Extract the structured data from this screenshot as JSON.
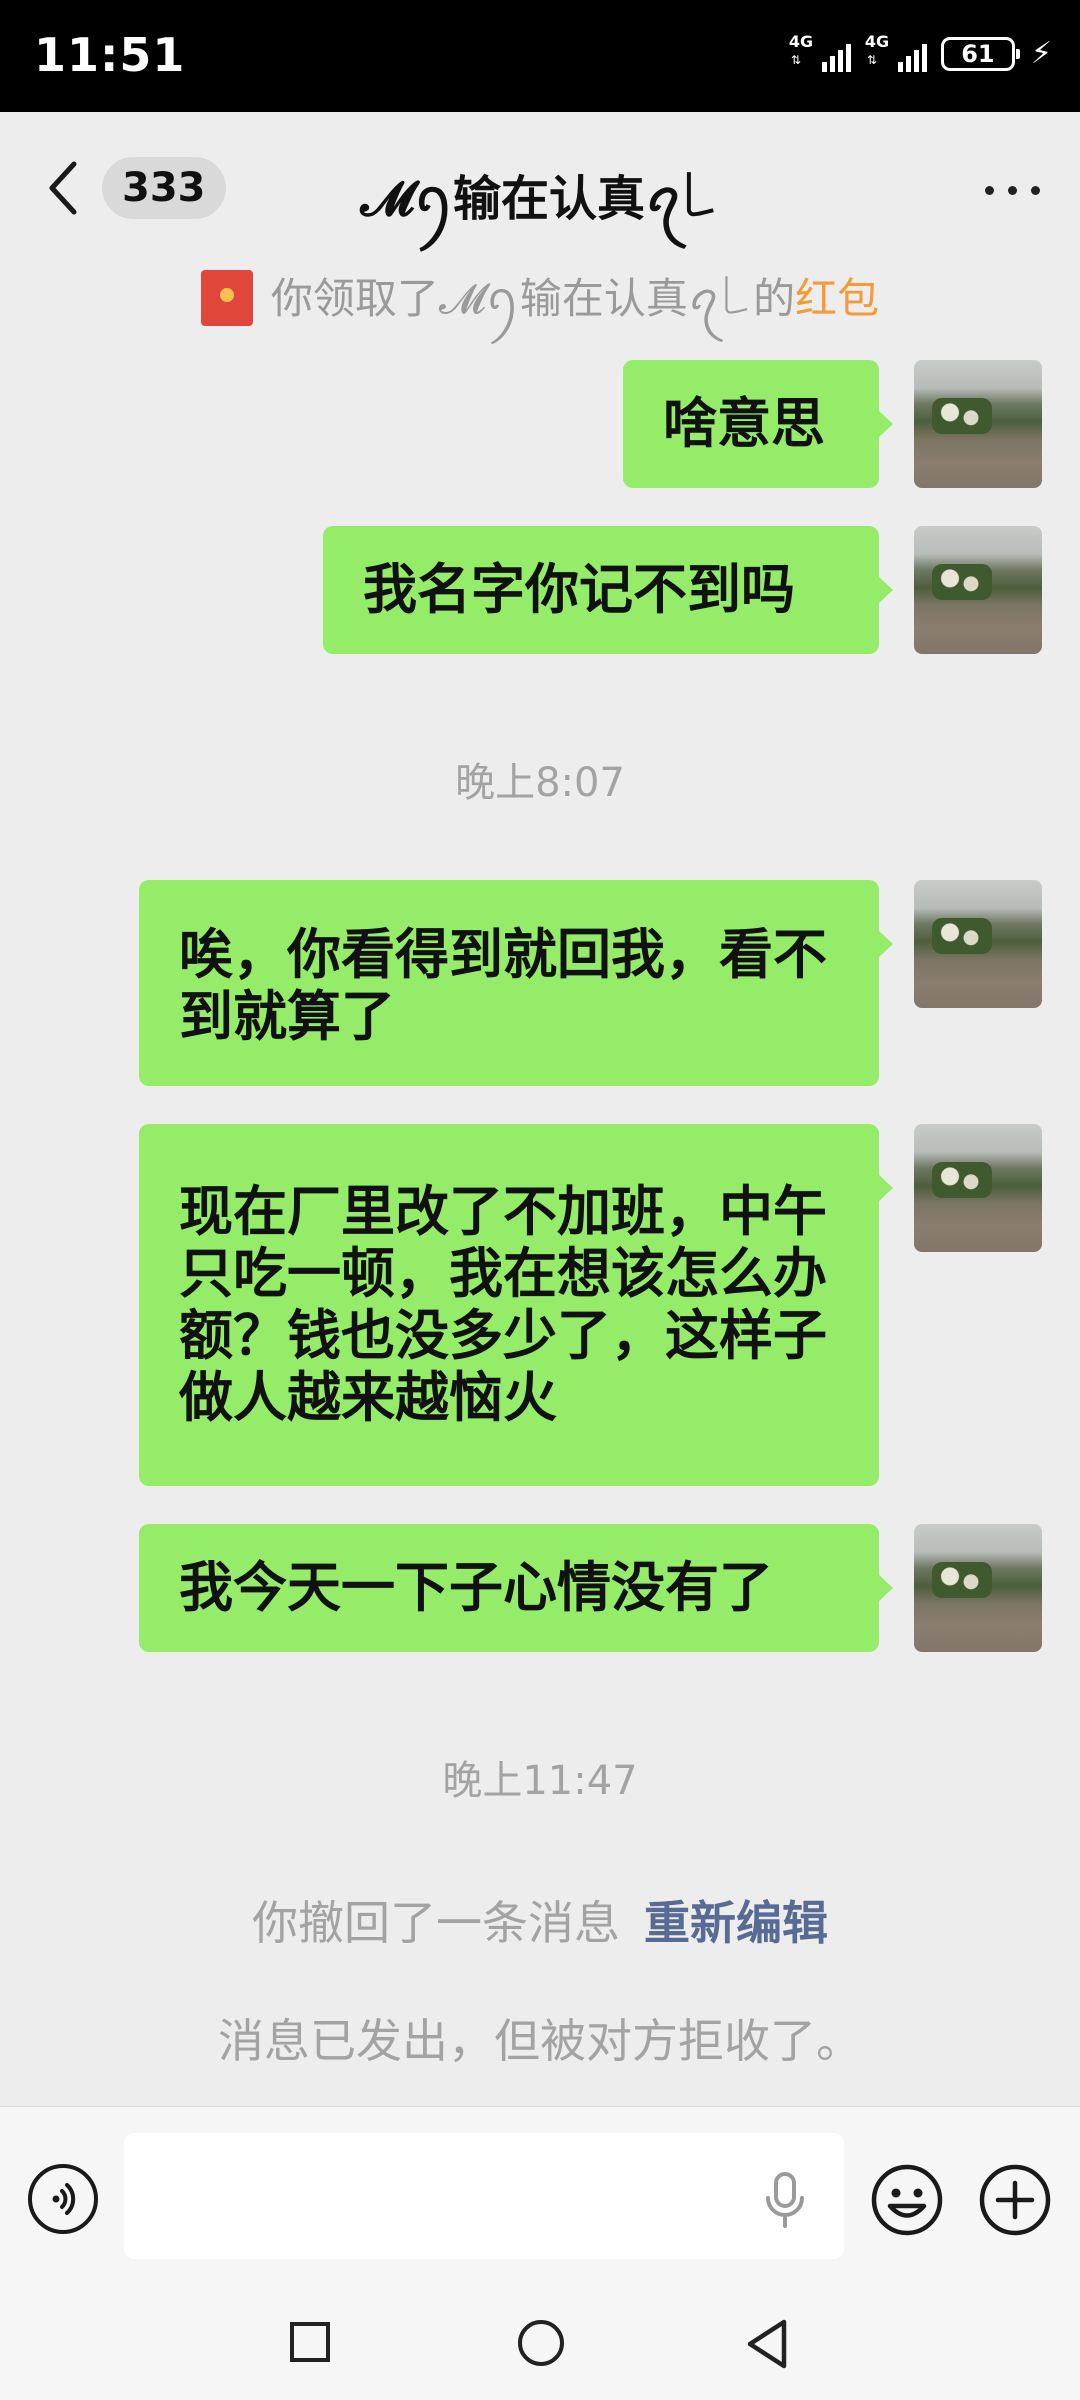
{
  "status_bar": {
    "time": "11:51",
    "network_1": "4G",
    "network_2": "4G",
    "battery": "61"
  },
  "header": {
    "unread_count": "333",
    "title": "𝓜ꪆ输在认真ꪖ꒒"
  },
  "notice": {
    "prefix": "你领取了𝓜ꪆ输在认真ꪖ꒒的",
    "link": "红包"
  },
  "messages": [
    {
      "text": "啥意思"
    },
    {
      "text": "我名字你记不到吗"
    },
    {
      "text": "唉，你看得到就回我，看不到就算了"
    },
    {
      "text": "现在厂里改了不加班，中午只吃一顿，我在想该怎么办额？钱也没多少了，这样子做人越来越恼火"
    },
    {
      "text": "我今天一下子心情没有了"
    }
  ],
  "time_labels": [
    "晚上8:07",
    "晚上11:47"
  ],
  "recall": {
    "text": "你撤回了一条消息",
    "action": "重新编辑"
  },
  "rejected_text": "消息已发出，但被对方拒收了。",
  "input": {
    "placeholder": ""
  },
  "icons": {
    "back": "chevron-left-icon",
    "more": "more-dots-icon",
    "voice": "voice-icon",
    "mic": "mic-icon",
    "emoji": "emoji-icon",
    "plus": "plus-icon"
  },
  "colors": {
    "bubble": "#95ec69",
    "background": "#ededed",
    "link_orange": "#f39b37",
    "link_blue": "#576b95"
  }
}
